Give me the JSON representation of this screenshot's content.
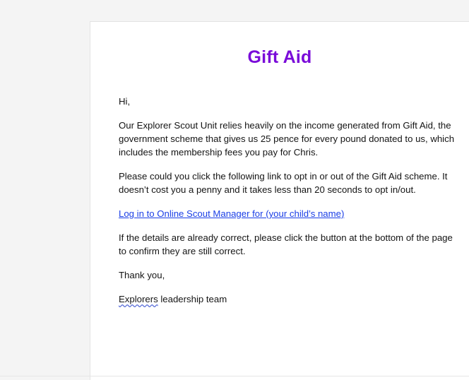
{
  "email": {
    "title": "Gift Aid",
    "greeting": "Hi,",
    "paragraph_1": "Our Explorer Scout Unit relies heavily on the income generated from Gift Aid, the government scheme that gives us 25 pence for every pound donated to us, which includes the membership fees you pay for Chris.",
    "paragraph_2": "Please could you click the following link to opt in or out of the Gift Aid scheme. It doesn’t cost you a penny and it takes less than 20 seconds to opt in/out.",
    "link_text": "Log in to Online Scout Manager for (your child’s name)",
    "paragraph_3": "If the details are already correct, please click the button at the bottom of the page to confirm they are still correct.",
    "sign_off": "Thank you,",
    "signature_word": "Explorers",
    "signature_rest": " leadership team"
  },
  "colors": {
    "title": "#7a0bd9",
    "link": "#1a3ee6",
    "text": "#141414",
    "background": "#f4f4f4",
    "page": "#ffffff"
  }
}
